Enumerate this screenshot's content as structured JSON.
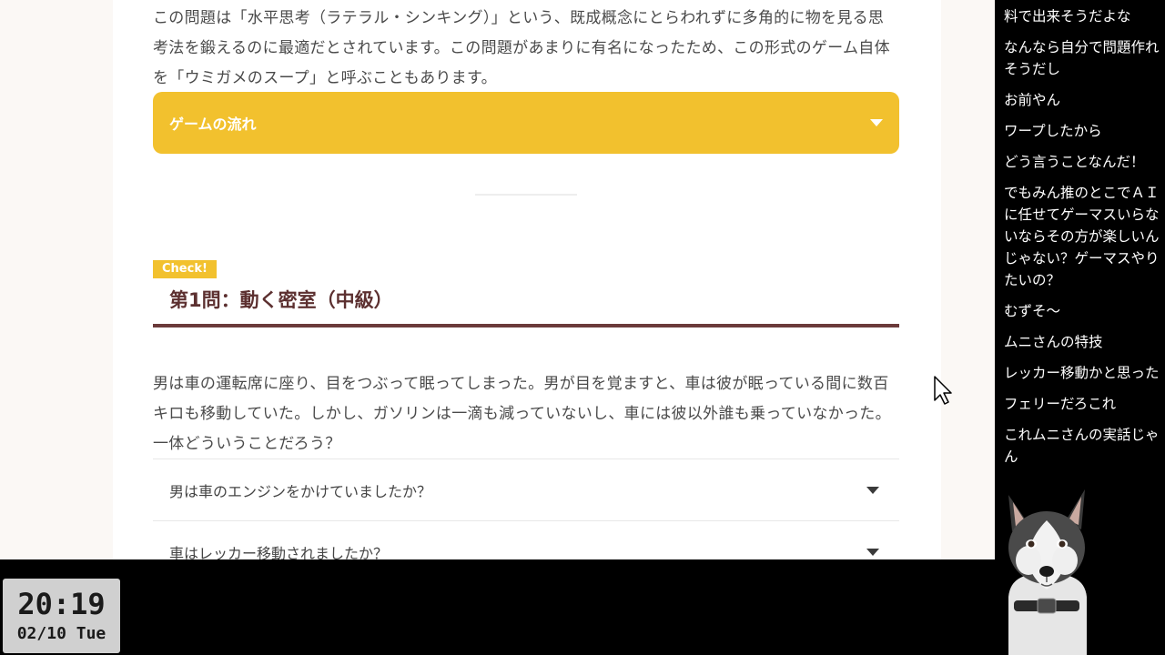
{
  "page": {
    "intro_paragraph": "この問題は「水平思考（ラテラル・シンキング）」という、既成概念にとらわれずに多角的に物を見る思考法を鍛えるのに最適だとされています。この問題があまりに有名になったため、この形式のゲーム自体を「ウミガメのスープ」と呼ぶこともあります。",
    "accordion_label": "ゲームの流れ",
    "check_badge": "Check!",
    "section_title": "第1問：動く密室（中級）",
    "question_paragraph": "男は車の運転席に座り、目をつぶって眠ってしまった。男が目を覚ますと、車は彼が眠っている間に数百キロも移動していた。しかし、ガソリンは一滴も減っていないし、車には彼以外誰も乗っていなかった。一体どういうことだろう？",
    "qa_items": [
      "男は車のエンジンをかけていましたか？",
      "車はレッカー移動されましたか？"
    ]
  },
  "chat": {
    "messages": [
      "料で出来そうだよな",
      "なんなら自分で問題作れそうだし",
      "お前やん",
      "ワープしたから",
      "どう言うことなんだ！",
      "でもみん推のとこでＡＩに任せてゲーマスいらないならその方が楽しいんじゃない？ゲーマスやりたいの？",
      "むずそ〜",
      "ムニさんの特技",
      "レッカー移動かと思った",
      "フェリーだろこれ",
      "これムニさんの実話じゃん"
    ]
  },
  "clock": {
    "time": "20:19",
    "date": "02/10 Tue"
  },
  "colors": {
    "accent_yellow": "#f2c12e",
    "title_brown": "#5c3030",
    "underline_brown": "#6b3a3a"
  }
}
